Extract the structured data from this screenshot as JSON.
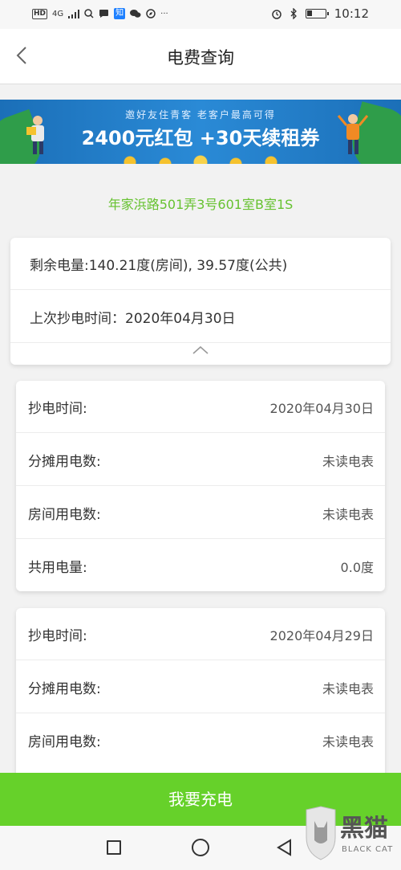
{
  "status_bar": {
    "network": "HD",
    "signal": "4G",
    "zhihu_icon_text": "知",
    "time": "10:12",
    "battery_level": 0.3
  },
  "navbar": {
    "title": "电费查询"
  },
  "banner": {
    "subtitle": "邀好友住青客 老客户最高可得",
    "headline": "2400元红包 +30天续租券"
  },
  "address": "年家浜路501弄3号601室B室1S",
  "summary": {
    "remaining": "剩余电量:140.21度(房间), 39.57度(公共)",
    "last_read": "上次抄电时间：2020年04月30日"
  },
  "records": [
    {
      "rows": [
        {
          "label": "抄电时间:",
          "value": "2020年04月30日"
        },
        {
          "label": "分摊用电数:",
          "value": "未读电表"
        },
        {
          "label": "房间用电数:",
          "value": "未读电表"
        },
        {
          "label": "共用电量:",
          "value": "0.0度"
        }
      ]
    },
    {
      "rows": [
        {
          "label": "抄电时间:",
          "value": "2020年04月29日"
        },
        {
          "label": "分摊用电数:",
          "value": "未读电表"
        },
        {
          "label": "房间用电数:",
          "value": "未读电表"
        }
      ]
    }
  ],
  "charge_button": "我要充电",
  "watermark": {
    "text": "黑猫",
    "sub": "BLACK CAT"
  },
  "colors": {
    "accent_green": "#66d12a",
    "address_green": "#66c230",
    "banner_blue": "#2a8ad6"
  }
}
